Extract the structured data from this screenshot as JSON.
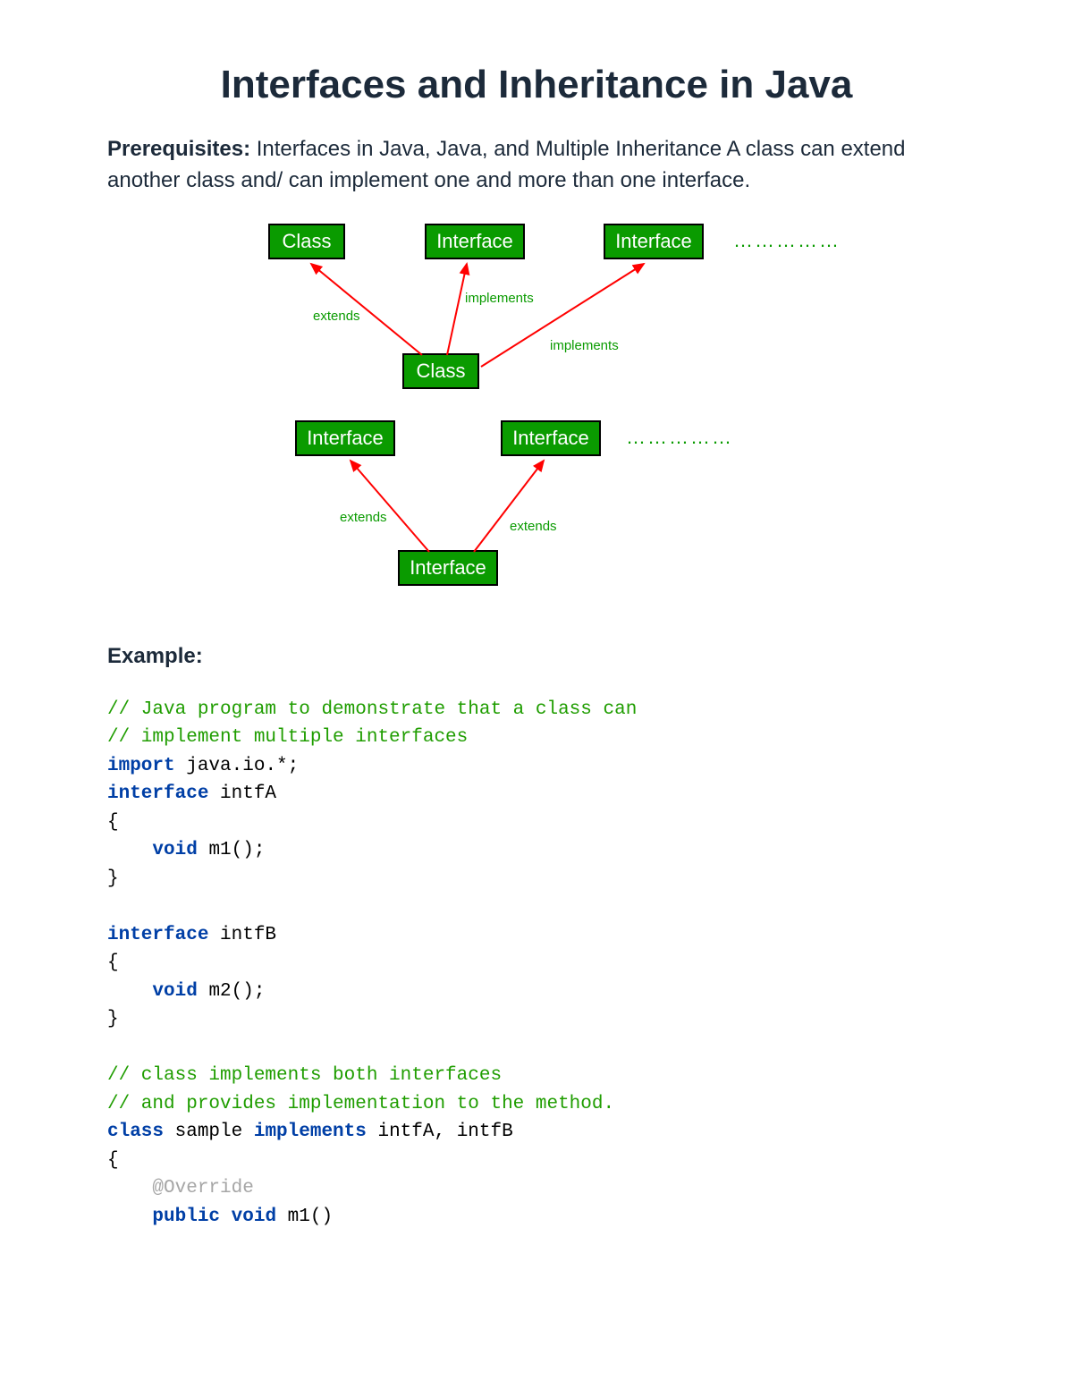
{
  "title": "Interfaces and Inheritance in Java",
  "intro_label": "Prerequisites:",
  "intro_text": " Interfaces in Java, Java, and Multiple Inheritance A class can extend another class and/ can implement one and more than one interface.",
  "diag1": {
    "top": {
      "a": "Class",
      "b": "Interface",
      "c": "Interface"
    },
    "dots": "……………",
    "labels": {
      "extends": "extends",
      "implements1": "implements",
      "implements2": "implements"
    },
    "bottom": "Class"
  },
  "diag2": {
    "top": {
      "a": "Interface",
      "b": "Interface"
    },
    "dots": "……………",
    "labels": {
      "extends1": "extends",
      "extends2": "extends"
    },
    "bottom": "Interface"
  },
  "example_heading": "Example:",
  "code": {
    "c1": "// Java program to demonstrate that a class can",
    "c2": "// implement multiple interfaces",
    "kw_import": "import",
    "l_import": " java.io.*;",
    "kw_interface": "interface",
    "l_intfA": " intfA",
    "brace_open": "{",
    "indent": "    ",
    "kw_void": "void",
    "l_m1": " m1();",
    "brace_close": "}",
    "l_intfB": " intfB",
    "l_m2": " m2();",
    "c3": "// class implements both interfaces",
    "c4": "// and provides implementation to the method.",
    "kw_class": "class",
    "l_sample": " sample ",
    "kw_implements": "implements",
    "l_impl_tail": " intfA, intfB",
    "ann_override": "@Override",
    "kw_public": "public",
    "sp": " ",
    "l_m1sig": " m1()"
  }
}
